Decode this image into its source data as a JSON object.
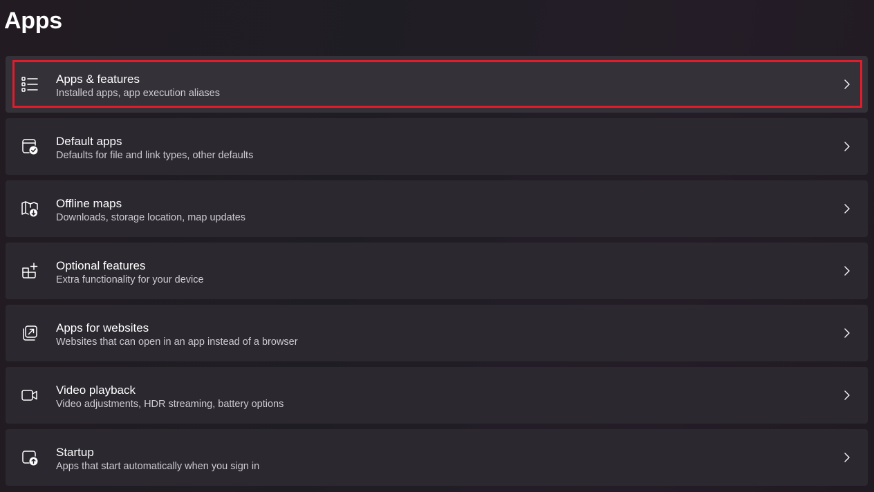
{
  "page": {
    "title": "Apps"
  },
  "colors": {
    "highlight_border": "#e01d2c",
    "row_background": "#2b2830",
    "description_text": "#cfcbd2"
  },
  "items": [
    {
      "title": "Apps & features",
      "description": "Installed apps, app execution aliases",
      "icon": "list-icon",
      "highlighted": true
    },
    {
      "title": "Default apps",
      "description": "Defaults for file and link types, other defaults",
      "icon": "default-apps-icon",
      "highlighted": false
    },
    {
      "title": "Offline maps",
      "description": "Downloads, storage location, map updates",
      "icon": "map-download-icon",
      "highlighted": false
    },
    {
      "title": "Optional features",
      "description": "Extra functionality for your device",
      "icon": "add-grid-icon",
      "highlighted": false
    },
    {
      "title": "Apps for websites",
      "description": "Websites that can open in an app instead of a browser",
      "icon": "open-in-app-icon",
      "highlighted": false
    },
    {
      "title": "Video playback",
      "description": "Video adjustments, HDR streaming, battery options",
      "icon": "video-camera-icon",
      "highlighted": false
    },
    {
      "title": "Startup",
      "description": "Apps that start automatically when you sign in",
      "icon": "startup-icon",
      "highlighted": false
    }
  ]
}
